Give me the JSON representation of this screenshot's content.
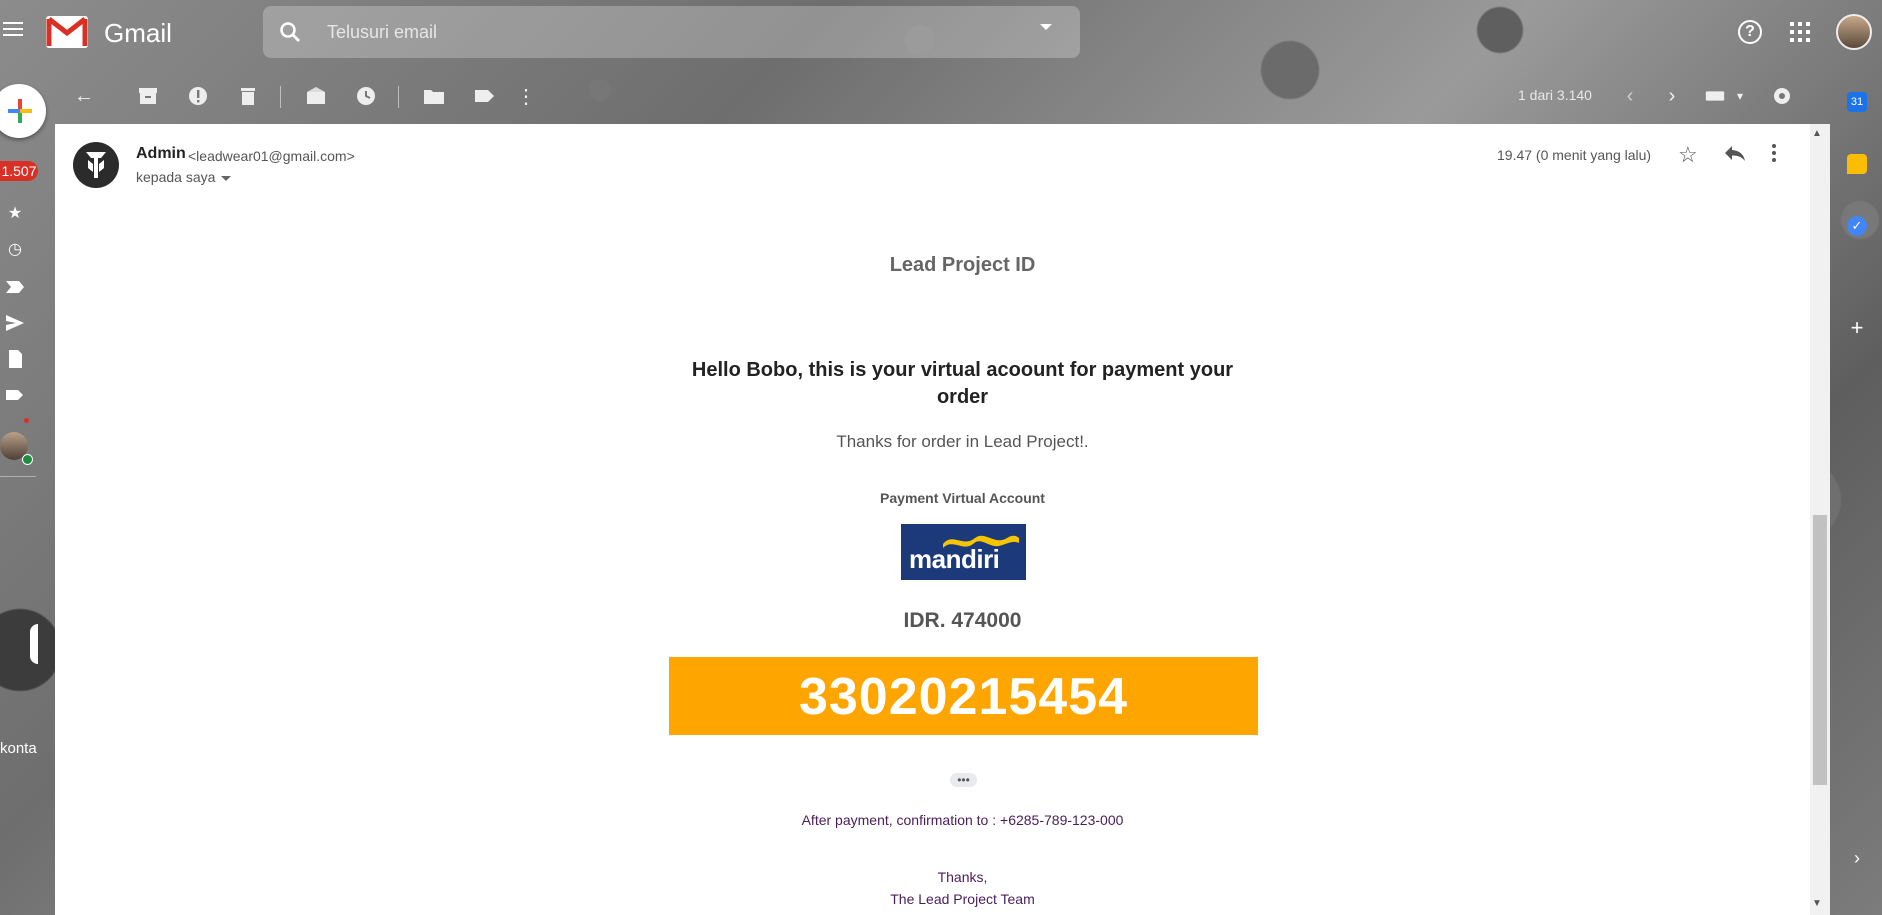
{
  "app": {
    "name": "Gmail",
    "search_placeholder": "Telusuri email"
  },
  "toolbar": {
    "pager_text": "1 dari 3.140"
  },
  "left_rail": {
    "inbox_count": "1.507",
    "contacts_label": "konta"
  },
  "side_panel": {
    "calendar_day": "31"
  },
  "message": {
    "sender_name": "Admin",
    "sender_email": "<leadwear01@gmail.com>",
    "recipient": "kepada saya",
    "time": "19.47 (0 menit yang lalu)"
  },
  "email_body": {
    "store_title": "Lead Project ID",
    "greeting": "Hello Bobo, this is your virtual acoount for payment your order",
    "thanks_line": "Thanks for order in Lead Project!.",
    "payment_label": "Payment Virtual Account",
    "bank_logo_text": "mandiri",
    "amount": "IDR. 474000",
    "va_number": "33020215454",
    "ellipsis": "•••",
    "confirmation": "After payment, confirmation to : +6285-789-123-000",
    "signoff_1": "Thanks,",
    "signoff_2": "The Lead Project Team"
  },
  "colors": {
    "va_box": "#ffa500",
    "bank_blue": "#1c3a7a",
    "bank_yellow": "#f7c400",
    "badge_red": "#d93025",
    "footer_text": "#4a1d5a"
  },
  "icons": {
    "toolbar": [
      "back-icon",
      "archive-icon",
      "report-spam-icon",
      "delete-icon",
      "mark-unread-icon",
      "snooze-icon",
      "move-to-icon",
      "label-icon",
      "more-icon",
      "prev-icon",
      "next-icon",
      "keyboard-icon",
      "settings-icon"
    ]
  }
}
